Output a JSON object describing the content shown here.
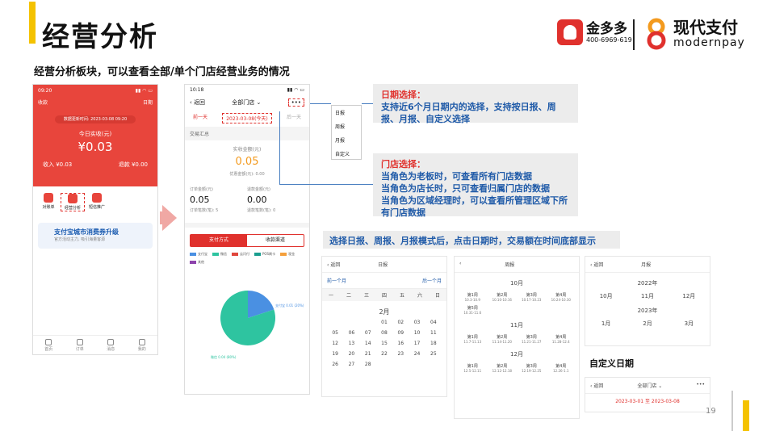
{
  "header": {
    "title": "经营分析",
    "subtitle": "经营分析板块，可以查看全部/单个门店经营业务的情况"
  },
  "logos": {
    "brand1": "金多多",
    "brand1_phone": "400-6969-619",
    "brand2": "现代支付",
    "brand2_en": "modernpay"
  },
  "phone1": {
    "time": "09:20",
    "back": "收款",
    "menu": "日期",
    "update": "数据更新时间: 2023-03-08 09:20",
    "today_label": "今日实收(元)",
    "amount": "¥0.03",
    "income_label": "收入 ¥0.03",
    "refund_label": "退款 ¥0.00",
    "icons": [
      "对账单",
      "经营分析",
      "短信推广"
    ],
    "banner_title": "支付宝城市消费券升级",
    "banner_sub": "官方活动主力, 吸引海量客源",
    "tabs": [
      "首页",
      "订单",
      "消息",
      "我的"
    ]
  },
  "phone2": {
    "time": "10:18",
    "back": "返回",
    "store": "全部门店",
    "more": "•••",
    "prev": "前一天",
    "date": "2023-03-08(今天)",
    "next": "后一天",
    "section": "交易汇总",
    "real_label": "实收金额(元)",
    "real_value": "0.05",
    "discount": "优惠金额(元): 0.00",
    "order_label": "订单金额(元)",
    "order_value": "0.05",
    "order_count": "订单笔数(笔): 5",
    "refund_label": "退款金额(元)",
    "refund_value": "0.00",
    "refund_count": "退款笔数(笔): 0",
    "tab_pay": "支付方式",
    "tab_channel": "收款渠道",
    "legend": [
      {
        "name": "支付宝",
        "color": "#4a90e2"
      },
      {
        "name": "微信",
        "color": "#2ec4a0"
      },
      {
        "name": "云闪付",
        "color": "#e0463c"
      },
      {
        "name": "POS刷卡",
        "color": "#1a9e8f"
      },
      {
        "name": "现金",
        "color": "#f5a03c"
      },
      {
        "name": "其他",
        "color": "#8e44ad"
      }
    ],
    "pie_alipay": "支付宝 0.01 (20%)",
    "pie_wechat": "微信 0.04 (80%)"
  },
  "dropdown": [
    "日报",
    "周报",
    "月报",
    "自定义"
  ],
  "callout1": {
    "head": "日期选择：",
    "body": "支持近6个月日期内的选择，支持按日报、周报、月报、自定义选择"
  },
  "callout2": {
    "head": "门店选择：",
    "lines": [
      "当角色为老板时，可查看所有门店数据",
      "当角色为店长时，只可查看归属门店的数据",
      "当角色为区域经理时，可以查看所管理区域下所有门店数据"
    ]
  },
  "hint": "选择日报、周报、月报模式后，点击日期时，交易额在时间底部显示",
  "cal_day": {
    "back": "返回",
    "title": "日报",
    "prev": "前一个月",
    "next": "后一个月",
    "weekdays": [
      "一",
      "二",
      "三",
      "四",
      "五",
      "六",
      "日"
    ],
    "month": "2月",
    "days": [
      "",
      "",
      "",
      "01",
      "02",
      "03",
      "04",
      "05",
      "06",
      "07",
      "08",
      "09",
      "10",
      "11",
      "12",
      "13",
      "14",
      "15",
      "16",
      "17",
      "18",
      "19",
      "20",
      "21",
      "22",
      "23",
      "24",
      "25",
      "26",
      "27",
      "28"
    ]
  },
  "cal_week": {
    "title": "周报",
    "months": [
      {
        "name": "10月",
        "weeks": [
          [
            "第1周",
            "10.3-10.9"
          ],
          [
            "第2周",
            "10.10-10.16"
          ],
          [
            "第3周",
            "10.17-10.23"
          ],
          [
            "第4周",
            "10.24-10.30"
          ],
          [
            "第5周",
            "10.31-11.6"
          ]
        ]
      },
      {
        "name": "11月",
        "weeks": [
          [
            "第1周",
            "11.7-11.13"
          ],
          [
            "第2周",
            "11.14-11.20"
          ],
          [
            "第3周",
            "11.21-11.27"
          ],
          [
            "第4周",
            "11.28-12.4"
          ]
        ]
      },
      {
        "name": "12月",
        "weeks": [
          [
            "第1周",
            "12.5-12.11"
          ],
          [
            "第2周",
            "12.12-12.18"
          ],
          [
            "第3周",
            "12.19-12.25"
          ],
          [
            "第4周",
            "12.26-1.1"
          ]
        ]
      }
    ]
  },
  "cal_month": {
    "back": "返回",
    "title": "月报",
    "years": [
      {
        "year": "2022年",
        "months": [
          "10月",
          "11月",
          "12月"
        ]
      },
      {
        "year": "2023年",
        "months": [
          "1月",
          "2月",
          "3月"
        ]
      }
    ]
  },
  "custom": {
    "title": "自定义日期",
    "back": "返回",
    "store": "全部门店",
    "range": "2023-03-01 至 2023-03-08"
  },
  "page": "19",
  "pie": {
    "alipay_pct": 20,
    "wechat_pct": 80
  }
}
